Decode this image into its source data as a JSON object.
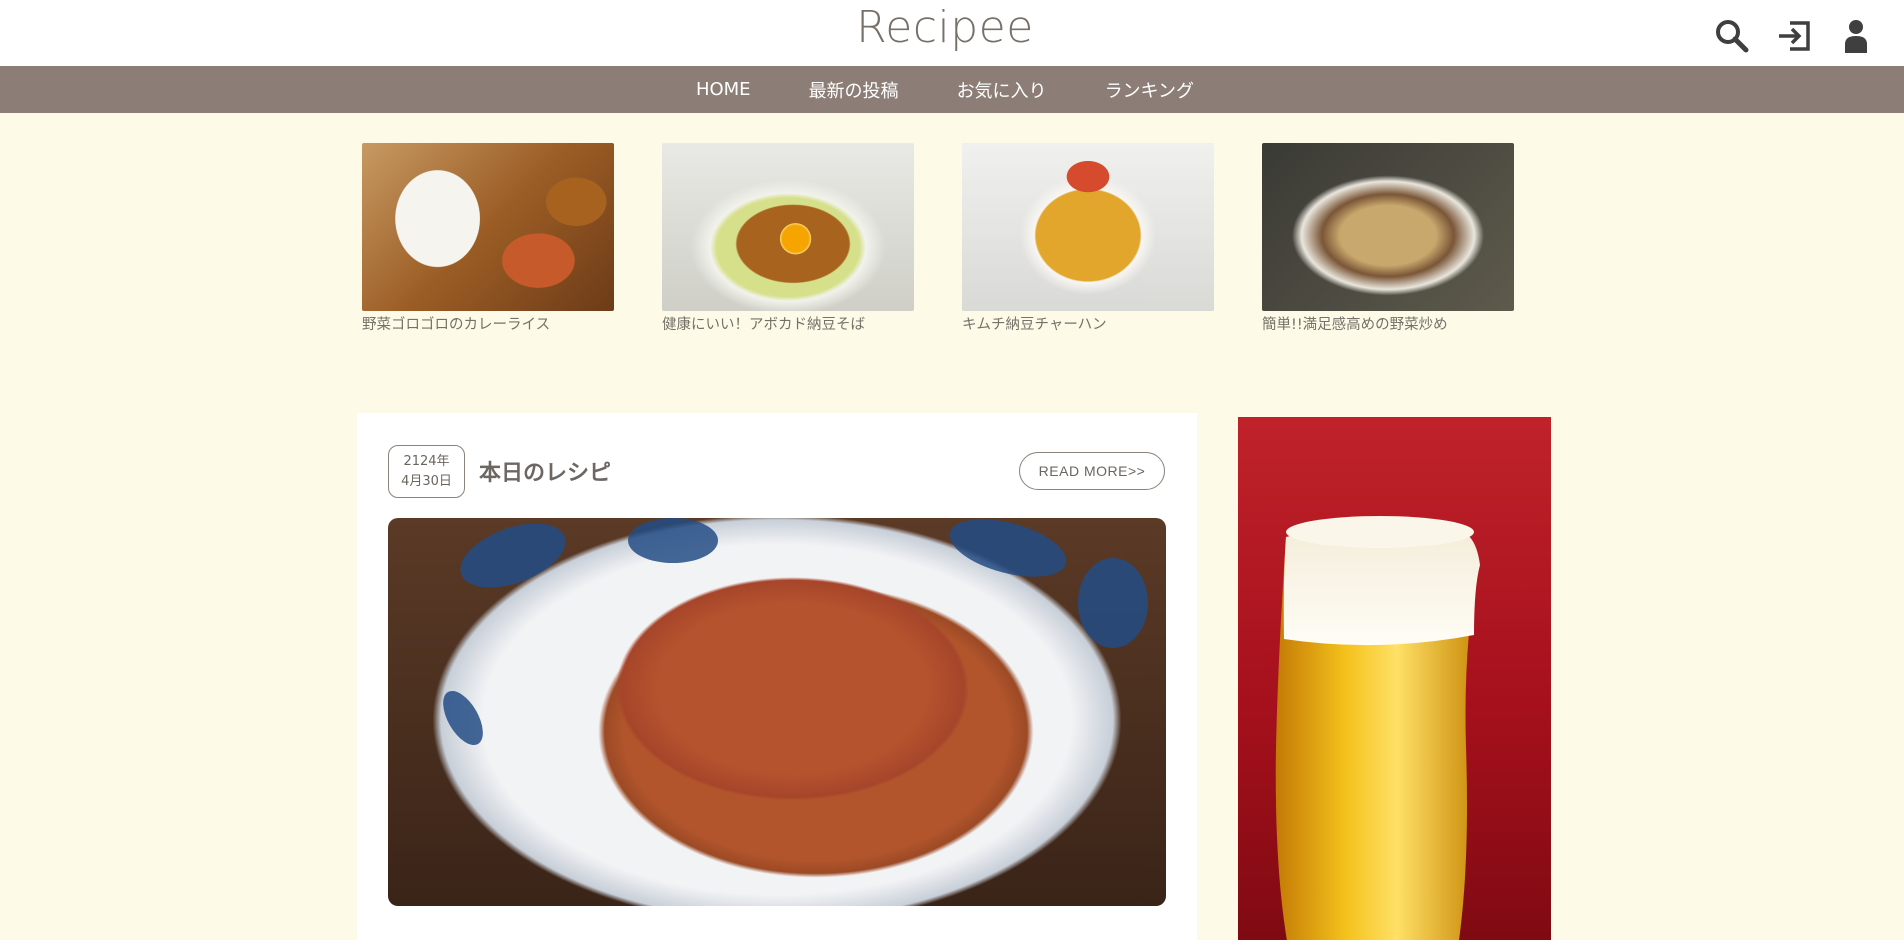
{
  "site": {
    "title": "Recipee"
  },
  "header": {
    "icons": [
      "search-icon",
      "login-icon",
      "user-icon"
    ]
  },
  "nav": {
    "items": [
      {
        "label": "HOME"
      },
      {
        "label": "最新の投稿"
      },
      {
        "label": "お気に入り"
      },
      {
        "label": "ランキング"
      }
    ]
  },
  "featured": [
    {
      "caption": "野菜ゴロゴロのカレーライス"
    },
    {
      "caption": "健康にいい！アボカド納豆そば"
    },
    {
      "caption": "キムチ納豆チャーハン"
    },
    {
      "caption": "簡単!!満足感高めの野菜炒め"
    }
  ],
  "today": {
    "date_year": "2124年",
    "date_day": "4月30日",
    "title": "本日のレシピ",
    "read_more": "READ MORE>>"
  },
  "colors": {
    "background": "#fdfbe7",
    "nav": "#8c7e76",
    "ad_red": "#c0222a"
  }
}
